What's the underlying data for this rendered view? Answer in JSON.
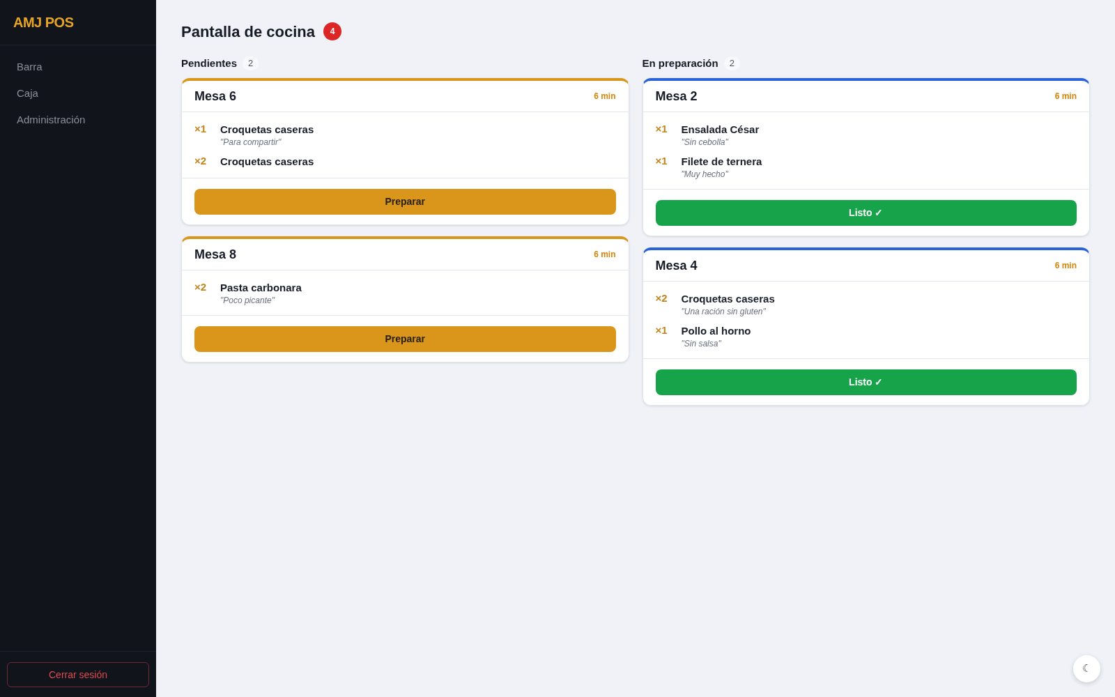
{
  "sidebar": {
    "logo": "AMJ POS",
    "items": [
      {
        "label": "Barra"
      },
      {
        "label": "Caja"
      },
      {
        "label": "Administración"
      }
    ],
    "logout": "Cerrar sesión"
  },
  "header": {
    "title": "Pantalla de cocina",
    "badge": "4"
  },
  "columns": [
    {
      "title": "Pendientes",
      "count": "2",
      "kind": "pending",
      "orders": [
        {
          "table": "Mesa 6",
          "time": "6 min",
          "items": [
            {
              "qty": "×1",
              "name": "Croquetas caseras",
              "note": "\"Para compartir\""
            },
            {
              "qty": "×2",
              "name": "Croquetas caseras"
            }
          ],
          "action": "Preparar"
        },
        {
          "table": "Mesa 8",
          "time": "6 min",
          "items": [
            {
              "qty": "×2",
              "name": "Pasta carbonara",
              "note": "\"Poco picante\""
            }
          ],
          "action": "Preparar"
        }
      ]
    },
    {
      "title": "En preparación",
      "count": "2",
      "kind": "preparing",
      "orders": [
        {
          "table": "Mesa 2",
          "time": "6 min",
          "items": [
            {
              "qty": "×1",
              "name": "Ensalada César",
              "note": "\"Sin cebolla\""
            },
            {
              "qty": "×1",
              "name": "Filete de ternera",
              "note": "\"Muy hecho\""
            }
          ],
          "action": "Listo ✓"
        },
        {
          "table": "Mesa 4",
          "time": "6 min",
          "items": [
            {
              "qty": "×2",
              "name": "Croquetas caseras",
              "note": "\"Una ración sin gluten\""
            },
            {
              "qty": "×1",
              "name": "Pollo al horno",
              "note": "\"Sin salsa\""
            }
          ],
          "action": "Listo ✓"
        }
      ]
    }
  ],
  "theme_toggle": "☾"
}
